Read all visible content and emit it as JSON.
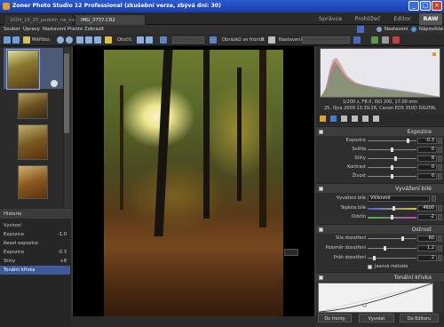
{
  "titlebar": {
    "title": "Zoner Photo Studio 12 Professional (zkušební verze, zbývá dní: 30)"
  },
  "doc_tabs": [
    "2004_10_25_podzim_na_vsrsi",
    "IMG_3737.CR2"
  ],
  "mode_tabs": [
    "Správce",
    "Prohlížeč",
    "Editor",
    "RAW"
  ],
  "menu": [
    "Soubor",
    "Úpravy",
    "Nastavení",
    "Pronto",
    "Zobrazit"
  ],
  "menu_right": {
    "settings": "Nastavení",
    "help": "Nápověda"
  },
  "toolbar": {
    "zoom_label": "Měřítko:",
    "rotate_label": "Otočit:",
    "queue_label": "Obrázků ve frontě:",
    "queue_count": "0",
    "settings_label": "Nastavení"
  },
  "history": {
    "title": "Historie",
    "items": [
      {
        "label": "Vychozí",
        "value": ""
      },
      {
        "label": "Expozice",
        "value": "-1.0"
      },
      {
        "label": "Reset expozice",
        "value": ""
      },
      {
        "label": "Expozice",
        "value": "-0.3"
      },
      {
        "label": "Stíny",
        "value": "+8"
      },
      {
        "label": "Tonální křivka",
        "value": ""
      }
    ]
  },
  "exif": {
    "line1": "1/200 s, F8.0, ISO 200, 17.00 mm",
    "line2": "25. října 2009 13:39:28, Canon EOS 350D DIGITAL"
  },
  "exposure": {
    "title": "Expozice",
    "rows": [
      {
        "label": "Expozice",
        "value": "-0.3"
      },
      {
        "label": "Světla",
        "value": "0"
      },
      {
        "label": "Stíny",
        "value": "8"
      },
      {
        "label": "Kontrast",
        "value": "0"
      },
      {
        "label": "Živost",
        "value": "0"
      }
    ]
  },
  "white_balance": {
    "title": "Vyvážení bílé",
    "mode_label": "Vyvážení bílé",
    "mode_value": "Vlčkovné",
    "rows": [
      {
        "label": "Teplota bílé",
        "value": "4600"
      },
      {
        "label": "Odstín",
        "value": "-2"
      }
    ]
  },
  "sharpness": {
    "title": "Ostrost",
    "rows": [
      {
        "label": "Síla doostření",
        "value": "60"
      },
      {
        "label": "Poloměr doostření",
        "value": "1.2"
      },
      {
        "label": "Práh doostření",
        "value": "2"
      }
    ],
    "checkbox": "Jasová metoda"
  },
  "tone_curve": {
    "title": "Tonální křivka"
  },
  "bottom_buttons": {
    "queue": "Do fronty",
    "develop": "Vyvolat",
    "editor": "Do Editoru"
  },
  "colors": {
    "accent": "#3d5a9a",
    "titlebar": "#2d5bd0",
    "panel": "#2e2e2e"
  }
}
